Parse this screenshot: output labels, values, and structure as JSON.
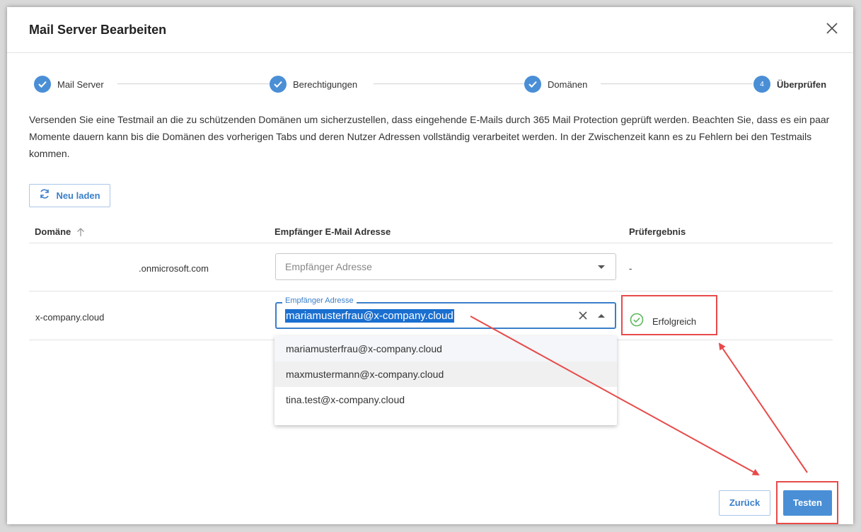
{
  "dialog": {
    "title": "Mail Server Bearbeiten"
  },
  "stepper": {
    "steps": [
      {
        "label": "Mail Server",
        "state": "done"
      },
      {
        "label": "Berechtigungen",
        "state": "done"
      },
      {
        "label": "Domänen",
        "state": "done"
      },
      {
        "label": "Überprüfen",
        "state": "active",
        "number": "4"
      }
    ]
  },
  "description": "Versenden Sie eine Testmail an die zu schützenden Domänen um sicherzustellen, dass eingehende E-Mails durch 365 Mail Protection geprüft werden. Beachten Sie, dass es ein paar Momente dauern kann bis die Domänen des vorherigen Tabs und deren Nutzer Adressen vollständig verarbeitet werden. In der Zwischenzeit kann es zu Fehlern bei den Testmails kommen.",
  "reload_label": "Neu laden",
  "table": {
    "headers": {
      "domain": "Domäne",
      "recipient": "Empfänger E-Mail Adresse",
      "result": "Prüfergebnis"
    },
    "rows": [
      {
        "domain": ".onmicrosoft.com",
        "recipient_placeholder": "Empfänger Adresse",
        "result": "-"
      },
      {
        "domain": "x-company.cloud",
        "recipient_label": "Empfänger Adresse",
        "recipient_value": "mariamusterfrau@x-company.cloud",
        "result": "Erfolgreich"
      }
    ]
  },
  "dropdown": {
    "options": [
      "mariamusterfrau@x-company.cloud",
      "maxmustermann@x-company.cloud",
      "tina.test@x-company.cloud"
    ]
  },
  "footer": {
    "back_label": "Zurück",
    "test_label": "Testen"
  },
  "colors": {
    "accent": "#4a8fd6",
    "success": "#5cb85c",
    "annotation": "#e84a4a"
  }
}
